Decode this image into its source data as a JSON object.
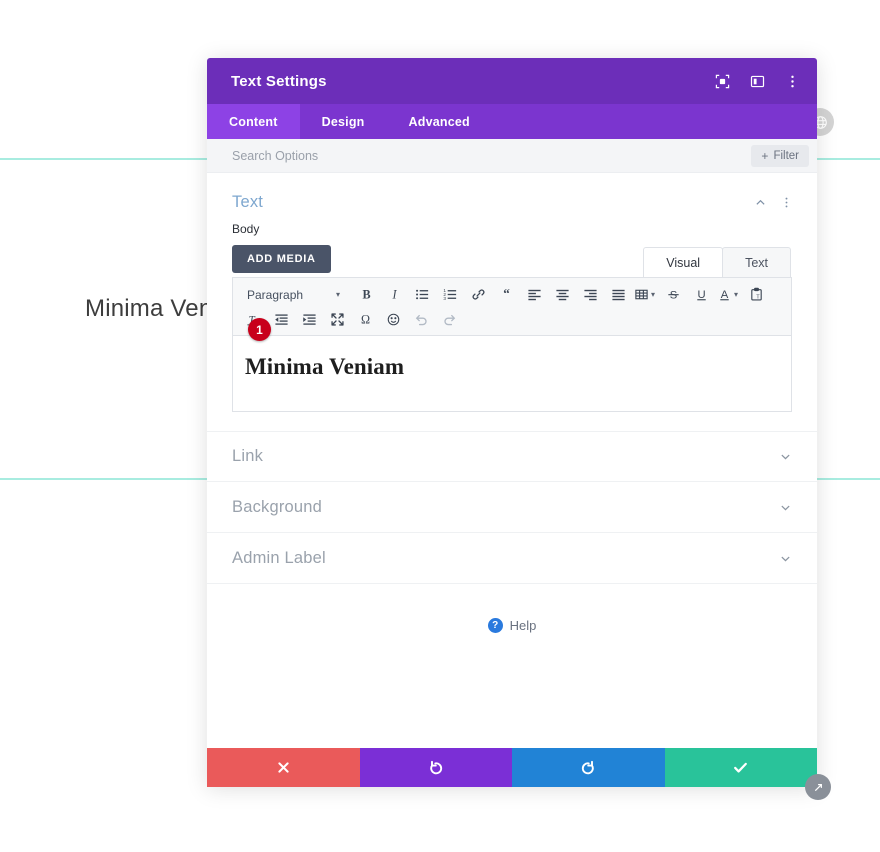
{
  "background": {
    "heading_text": "Minima Ven",
    "divider_color": "#a8ece0",
    "globe_icon": "globe-icon"
  },
  "modal": {
    "title": "Text Settings",
    "header_color": "#6c2eb9",
    "tabbar_color": "#7b35cf",
    "header_icons": [
      {
        "name": "focus-mode-icon",
        "label": "Focus Mode"
      },
      {
        "name": "panel-layout-icon",
        "label": "Panel Layout"
      },
      {
        "name": "more-options-icon",
        "label": "More Options"
      }
    ],
    "tabs": [
      {
        "label": "Content",
        "active": true
      },
      {
        "label": "Design",
        "active": false
      },
      {
        "label": "Advanced",
        "active": false
      }
    ],
    "search": {
      "placeholder": "Search Options",
      "value": ""
    },
    "filter_button": {
      "label": "Filter",
      "plus": "+"
    },
    "section": {
      "title": "Text",
      "collapse_icon": "chevron-up-icon",
      "menu_icon": "more-options-icon"
    },
    "field": {
      "label": "Body",
      "add_media_label": "ADD MEDIA"
    },
    "editor": {
      "tabs": [
        {
          "label": "Visual",
          "active": true
        },
        {
          "label": "Text",
          "active": false
        }
      ],
      "format_select": {
        "value": "Paragraph"
      },
      "toolbar_row1": [
        {
          "name": "bold-icon",
          "glyph": "B"
        },
        {
          "name": "italic-icon",
          "glyph": "I"
        },
        {
          "name": "bulleted-list-icon",
          "glyph": "list"
        },
        {
          "name": "numbered-list-icon",
          "glyph": "olist"
        },
        {
          "name": "link-icon",
          "glyph": "link"
        },
        {
          "name": "blockquote-icon",
          "glyph": "quote"
        },
        {
          "name": "align-left-icon",
          "glyph": "alignleft"
        },
        {
          "name": "align-center-icon",
          "glyph": "aligncenter"
        },
        {
          "name": "align-right-icon",
          "glyph": "alignright"
        },
        {
          "name": "align-justify-icon",
          "glyph": "alignjustify"
        },
        {
          "name": "table-icon",
          "glyph": "table",
          "caret": true
        },
        {
          "name": "strikethrough-icon",
          "glyph": "strike"
        },
        {
          "name": "underline-icon",
          "glyph": "underline"
        },
        {
          "name": "text-color-icon",
          "glyph": "textcolor",
          "caret": true
        },
        {
          "name": "paste-as-text-icon",
          "glyph": "paste"
        }
      ],
      "toolbar_row2": [
        {
          "name": "clear-formatting-icon",
          "glyph": "clearformat"
        },
        {
          "name": "outdent-icon",
          "glyph": "outdent"
        },
        {
          "name": "indent-icon",
          "glyph": "indent"
        },
        {
          "name": "fullscreen-icon",
          "glyph": "fullscreen"
        },
        {
          "name": "special-character-icon",
          "glyph": "omega"
        },
        {
          "name": "emoji-icon",
          "glyph": "emoji"
        },
        {
          "name": "undo-icon",
          "glyph": "undo"
        },
        {
          "name": "redo-icon",
          "glyph": "redo"
        }
      ],
      "content": "Minima Veniam",
      "step_badge": "1"
    },
    "accordions": [
      {
        "label": "Link",
        "icon": "chevron-down-icon"
      },
      {
        "label": "Background",
        "icon": "chevron-down-icon"
      },
      {
        "label": "Admin Label",
        "icon": "chevron-down-icon"
      }
    ],
    "help": {
      "marker": "?",
      "label": "Help"
    },
    "footer_buttons": [
      {
        "name": "cancel-button",
        "icon": "close-icon",
        "color": "#ea5a5a"
      },
      {
        "name": "undo-button",
        "icon": "undo-arrow-icon",
        "color": "#7b2fd6"
      },
      {
        "name": "redo-button",
        "icon": "redo-arrow-icon",
        "color": "#2183d6"
      },
      {
        "name": "save-button",
        "icon": "check-icon",
        "color": "#29c39a"
      }
    ],
    "resize_handle_icon": "resize-handle-icon"
  }
}
